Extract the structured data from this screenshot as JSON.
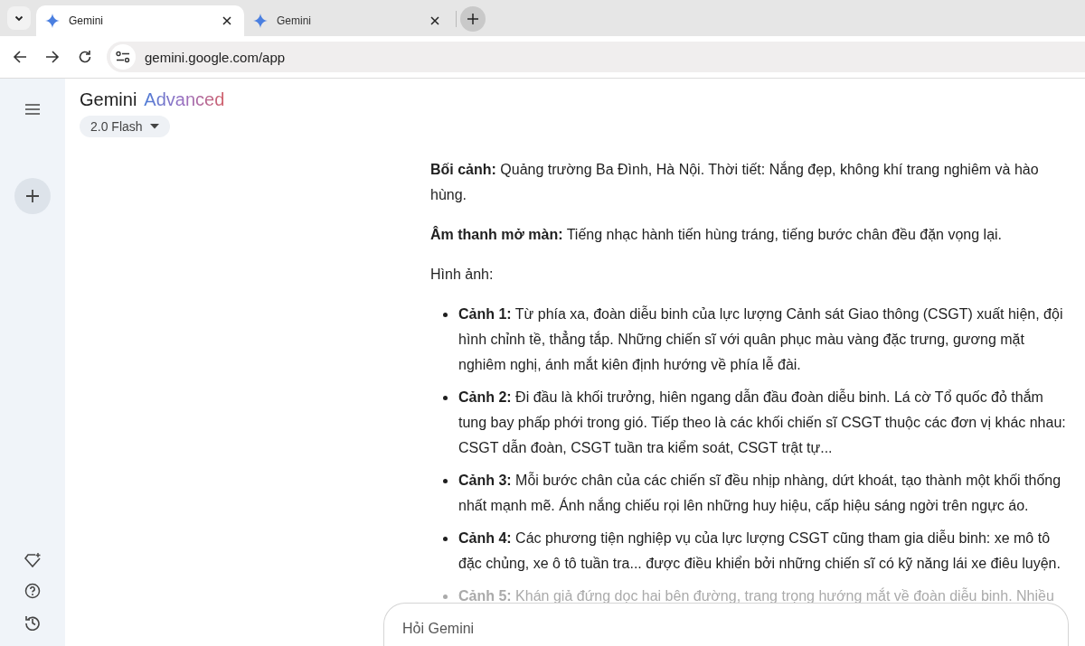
{
  "tabs": [
    {
      "title": "Gemini",
      "selected": true
    },
    {
      "title": "Gemini",
      "selected": false
    }
  ],
  "address_bar": {
    "url": "gemini.google.com/app"
  },
  "header": {
    "brand": "Gemini",
    "tier": "Advanced",
    "model": "2.0 Flash"
  },
  "paragraphs": [
    "**Bối cảnh:** Quảng trường Ba Đình, Hà Nội. Thời tiết: Nắng đẹp, không khí trang nghiêm và hào hùng.",
    "**Âm thanh mở màn:** Tiếng nhạc hành tiến hùng tráng, tiếng bước chân đều đặn vọng lại.",
    "Hình ảnh:"
  ],
  "scenes": [
    {
      "text": "**Cảnh 1:** Từ phía xa, đoàn diễu binh của lực lượng Cảnh sát Giao thông (CSGT) xuất hiện, đội hình chỉnh tề, thẳng tắp. Những chiến sĩ với quân phục màu vàng đặc trưng, gương mặt nghiêm nghị, ánh mắt kiên định hướng về phía lễ đài.",
      "faded": false
    },
    {
      "text": "**Cảnh 2:** Đi đầu là khối trưởng, hiên ngang dẫn đầu đoàn diễu binh. Lá cờ Tổ quốc đỏ thắm tung bay phấp phới trong gió. Tiếp theo là các khối chiến sĩ CSGT thuộc các đơn vị khác nhau: CSGT dẫn đoàn, CSGT tuần tra kiểm soát, CSGT trật tự...",
      "faded": false
    },
    {
      "text": "**Cảnh 3:** Mỗi bước chân của các chiến sĩ đều nhịp nhàng, dứt khoát, tạo thành một khối thống nhất mạnh mẽ. Ánh nắng chiếu rọi lên những huy hiệu, cấp hiệu sáng ngời trên ngực áo.",
      "faded": false
    },
    {
      "text": "**Cảnh 4:** Các phương tiện nghiệp vụ của lực lượng CSGT cũng tham gia diễu binh: xe mô tô đặc chủng, xe ô tô tuần tra... được điều khiển bởi những chiến sĩ có kỹ năng lái xe điêu luyện.",
      "faded": false
    },
    {
      "text": "**Cảnh 5:** Khán giả đứng dọc hai bên đường, trang trọng hướng mắt về đoàn diễu binh. Nhiều",
      "faded": true
    }
  ],
  "prompt": {
    "placeholder": "Hỏi Gemini"
  }
}
